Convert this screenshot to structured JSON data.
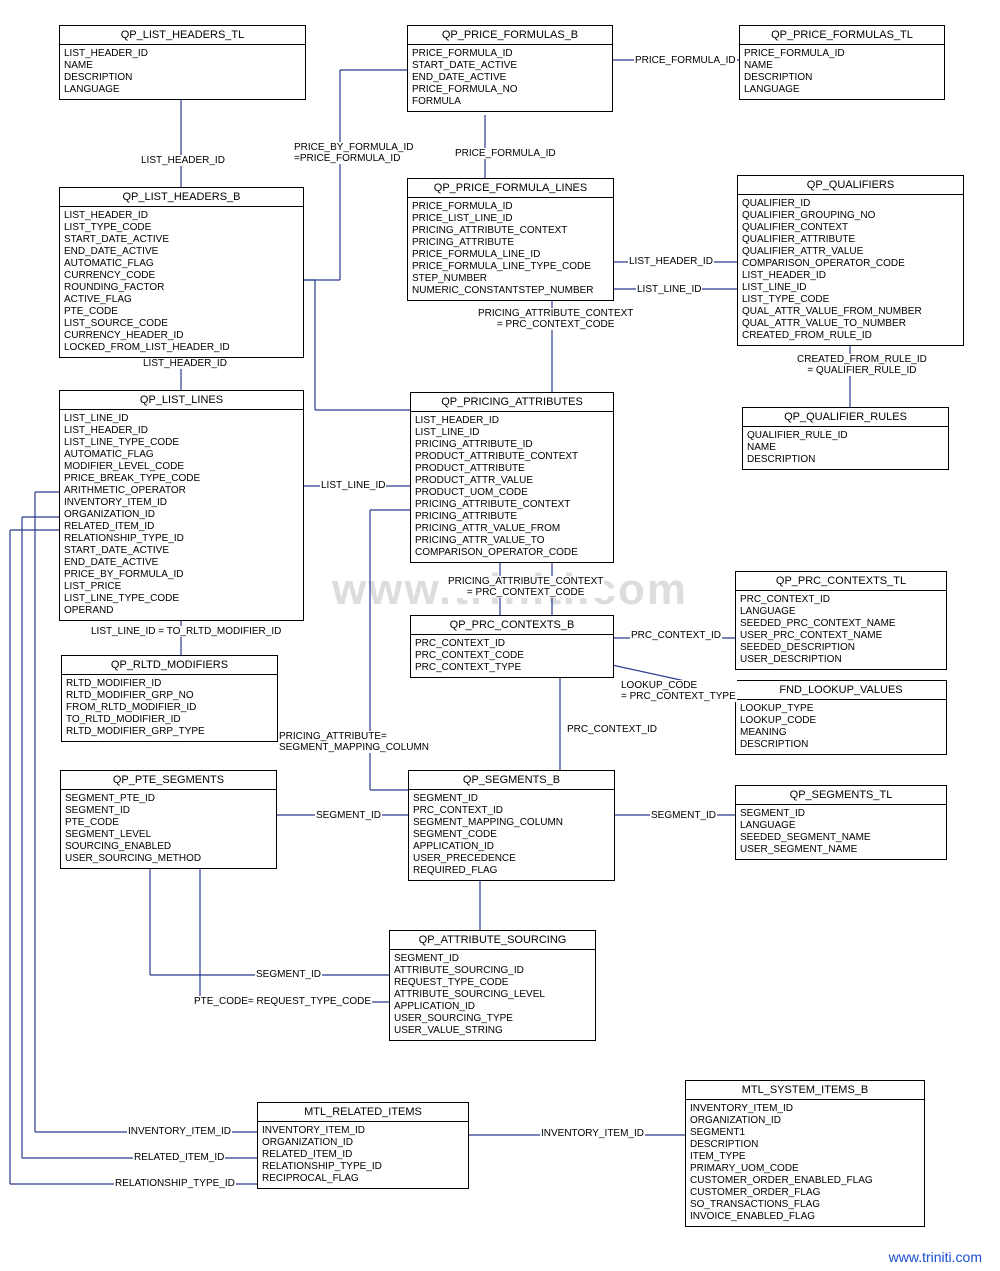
{
  "watermark": "www.triniti.com",
  "footer": "www.triniti.com",
  "entities": {
    "list_headers_tl": {
      "title": "QP_LIST_HEADERS_TL",
      "fields": [
        "LIST_HEADER_ID",
        "NAME",
        "DESCRIPTION",
        "LANGUAGE"
      ]
    },
    "price_formulas_b": {
      "title": "QP_PRICE_FORMULAS_B",
      "fields": [
        "PRICE_FORMULA_ID",
        "START_DATE_ACTIVE",
        "END_DATE_ACTIVE",
        "PRICE_FORMULA_NO",
        "FORMULA"
      ]
    },
    "price_formulas_tl": {
      "title": "QP_PRICE_FORMULAS_TL",
      "fields": [
        "PRICE_FORMULA_ID",
        "NAME",
        "DESCRIPTION",
        "LANGUAGE"
      ]
    },
    "list_headers_b": {
      "title": "QP_LIST_HEADERS_B",
      "fields": [
        "LIST_HEADER_ID",
        "LIST_TYPE_CODE",
        "START_DATE_ACTIVE",
        "END_DATE_ACTIVE",
        "AUTOMATIC_FLAG",
        "CURRENCY_CODE",
        "ROUNDING_FACTOR",
        "ACTIVE_FLAG",
        "PTE_CODE",
        "LIST_SOURCE_CODE",
        "CURRENCY_HEADER_ID",
        "LOCKED_FROM_LIST_HEADER_ID"
      ]
    },
    "price_formula_lines": {
      "title": "QP_PRICE_FORMULA_LINES",
      "fields": [
        "PRICE_FORMULA_ID",
        "PRICE_LIST_LINE_ID",
        "PRICING_ATTRIBUTE_CONTEXT",
        "PRICING_ATTRIBUTE",
        "PRICE_FORMULA_LINE_ID",
        "PRICE_FORMULA_LINE_TYPE_CODE",
        "STEP_NUMBER",
        "NUMERIC_CONSTANTSTEP_NUMBER"
      ]
    },
    "qualifiers": {
      "title": "QP_QUALIFIERS",
      "fields": [
        "QUALIFIER_ID",
        "QUALIFIER_GROUPING_NO",
        "QUALIFIER_CONTEXT",
        "QUALIFIER_ATTRIBUTE",
        "QUALIFIER_ATTR_VALUE",
        "COMPARISON_OPERATOR_CODE",
        "LIST_HEADER_ID",
        "LIST_LINE_ID",
        "LIST_TYPE_CODE",
        "QUAL_ATTR_VALUE_FROM_NUMBER",
        "QUAL_ATTR_VALUE_TO_NUMBER",
        "CREATED_FROM_RULE_ID"
      ]
    },
    "list_lines": {
      "title": "QP_LIST_LINES",
      "fields": [
        "LIST_LINE_ID",
        "LIST_HEADER_ID",
        "LIST_LINE_TYPE_CODE",
        "AUTOMATIC_FLAG",
        "MODIFIER_LEVEL_CODE",
        "PRICE_BREAK_TYPE_CODE",
        "ARITHMETIC_OPERATOR",
        "INVENTORY_ITEM_ID",
        "ORGANIZATION_ID",
        "RELATED_ITEM_ID",
        "RELATIONSHIP_TYPE_ID",
        "START_DATE_ACTIVE",
        "END_DATE_ACTIVE",
        "PRICE_BY_FORMULA_ID",
        "LIST_PRICE",
        "LIST_LINE_TYPE_CODE",
        "OPERAND"
      ]
    },
    "pricing_attributes": {
      "title": "QP_PRICING_ATTRIBUTES",
      "fields": [
        "LIST_HEADER_ID",
        "LIST_LINE_ID",
        "PRICING_ATTRIBUTE_ID",
        "PRODUCT_ATTRIBUTE_CONTEXT",
        "PRODUCT_ATTRIBUTE",
        "PRODUCT_ATTR_VALUE",
        "PRODUCT_UOM_CODE",
        "PRICING_ATTRIBUTE_CONTEXT",
        "PRICING_ATTRIBUTE",
        "PRICING_ATTR_VALUE_FROM",
        "PRICING_ATTR_VALUE_TO",
        "COMPARISON_OPERATOR_CODE"
      ]
    },
    "qualifier_rules": {
      "title": "QP_QUALIFIER_RULES",
      "fields": [
        "QUALIFIER_RULE_ID",
        "NAME",
        "DESCRIPTION"
      ]
    },
    "prc_contexts_tl": {
      "title": "QP_PRC_CONTEXTS_TL",
      "fields": [
        "PRC_CONTEXT_ID",
        "LANGUAGE",
        "SEEDED_PRC_CONTEXT_NAME",
        "USER_PRC_CONTEXT_NAME",
        "SEEDED_DESCRIPTION",
        "USER_DESCRIPTION"
      ]
    },
    "rltd_modifiers": {
      "title": "QP_RLTD_MODIFIERS",
      "fields": [
        "RLTD_MODIFIER_ID",
        "RLTD_MODIFIER_GRP_NO",
        "FROM_RLTD_MODIFIER_ID",
        "TO_RLTD_MODIFIER_ID",
        "RLTD_MODIFIER_GRP_TYPE"
      ]
    },
    "prc_contexts_b": {
      "title": "QP_PRC_CONTEXTS_B",
      "fields": [
        "PRC_CONTEXT_ID",
        "PRC_CONTEXT_CODE",
        "PRC_CONTEXT_TYPE"
      ]
    },
    "fnd_lookup_values": {
      "title": "FND_LOOKUP_VALUES",
      "fields": [
        "LOOKUP_TYPE",
        "LOOKUP_CODE",
        "MEANING",
        "DESCRIPTION"
      ]
    },
    "pte_segments": {
      "title": "QP_PTE_SEGMENTS",
      "fields": [
        "SEGMENT_PTE_ID",
        "SEGMENT_ID",
        "PTE_CODE",
        "SEGMENT_LEVEL",
        "SOURCING_ENABLED",
        "USER_SOURCING_METHOD"
      ]
    },
    "segments_b": {
      "title": "QP_SEGMENTS_B",
      "fields": [
        "SEGMENT_ID",
        "PRC_CONTEXT_ID",
        "SEGMENT_MAPPING_COLUMN",
        "SEGMENT_CODE",
        "APPLICATION_ID",
        "USER_PRECEDENCE",
        "REQUIRED_FLAG"
      ]
    },
    "segments_tl": {
      "title": "QP_SEGMENTS_TL",
      "fields": [
        "SEGMENT_ID",
        "LANGUAGE",
        "SEEDED_SEGMENT_NAME",
        "USER_SEGMENT_NAME"
      ]
    },
    "attribute_sourcing": {
      "title": "QP_ATTRIBUTE_SOURCING",
      "fields": [
        "SEGMENT_ID",
        "ATTRIBUTE_SOURCING_ID",
        "REQUEST_TYPE_CODE",
        "ATTRIBUTE_SOURCING_LEVEL",
        "APPLICATION_ID",
        "USER_SOURCING_TYPE",
        "USER_VALUE_STRING"
      ]
    },
    "related_items": {
      "title": "MTL_RELATED_ITEMS",
      "fields": [
        "INVENTORY_ITEM_ID",
        "ORGANIZATION_ID",
        "RELATED_ITEM_ID",
        "RELATIONSHIP_TYPE_ID",
        "RECIPROCAL_FLAG"
      ]
    },
    "system_items_b": {
      "title": "MTL_SYSTEM_ITEMS_B",
      "fields": [
        "INVENTORY_ITEM_ID",
        "ORGANIZATION_ID",
        "SEGMENT1",
        "DESCRIPTION",
        "ITEM_TYPE",
        "PRIMARY_UOM_CODE",
        "CUSTOMER_ORDER_ENABLED_FLAG",
        "CUSTOMER_ORDER_FLAG",
        "SO_TRANSACTIONS_FLAG",
        "INVOICE_ENABLED_FLAG"
      ]
    }
  },
  "labels": {
    "l1": "LIST_HEADER_ID",
    "l2": "PRICE_BY_FORMULA_ID\n=PRICE_FORMULA_ID",
    "l3": "PRICE_FORMULA_ID",
    "l4": "PRICE_FORMULA_ID",
    "l5": "LIST_HEADER_ID",
    "l6": "LIST_LINE_ID",
    "l7": "PRICING_ATTRIBUTE_CONTEXT\n= PRC_CONTEXT_CODE",
    "l8": "LIST_HEADER_ID",
    "l9": "CREATED_FROM_RULE_ID\n= QUALIFIER_RULE_ID",
    "l10": "LIST_LINE_ID",
    "l11": "PRICING_ATTRIBUTE_CONTEXT\n= PRC_CONTEXT_CODE",
    "l12": "PRC_CONTEXT_ID",
    "l13": "LOOKUP_CODE\n= PRC_CONTEXT_TYPE",
    "l14": "LIST_LINE_ID  =  TO_RLTD_MODIFIER_ID",
    "l15": "PRICING_ATTRIBUTE=\nSEGMENT_MAPPING_COLUMN",
    "l16": "PRC_CONTEXT_ID",
    "l17": "SEGMENT_ID",
    "l18": "SEGMENT_ID",
    "l19": "SEGMENT_ID",
    "l20": "PTE_CODE=  REQUEST_TYPE_CODE",
    "l21": "INVENTORY_ITEM_ID",
    "l22": "RELATED_ITEM_ID",
    "l23": "RELATIONSHIP_TYPE_ID",
    "l24": "INVENTORY_ITEM_ID"
  }
}
